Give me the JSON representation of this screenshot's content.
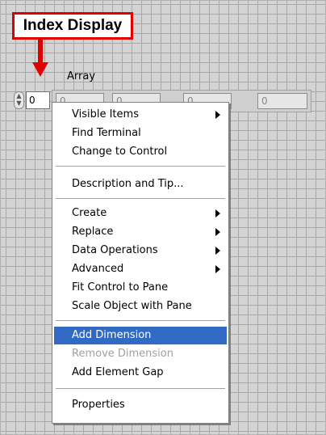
{
  "callout": {
    "text": "Index Display"
  },
  "array": {
    "label": "Array",
    "index_value": "0",
    "element_values": [
      "0",
      "0",
      "0",
      "0"
    ]
  },
  "menu": {
    "items": [
      {
        "label": "Visible Items",
        "submenu": true
      },
      {
        "label": "Find Terminal"
      },
      {
        "label": "Change to Control"
      },
      {
        "label": "Description and Tip..."
      },
      {
        "label": "Create",
        "submenu": true
      },
      {
        "label": "Replace",
        "submenu": true
      },
      {
        "label": "Data Operations",
        "submenu": true
      },
      {
        "label": "Advanced",
        "submenu": true
      },
      {
        "label": "Fit Control to Pane"
      },
      {
        "label": "Scale Object with Pane"
      },
      {
        "label": "Add Dimension",
        "selected": true
      },
      {
        "label": "Remove Dimension",
        "disabled": true
      },
      {
        "label": "Add Element Gap"
      },
      {
        "label": "Properties"
      }
    ]
  },
  "colors": {
    "callout_border": "#e00000",
    "selection": "#316ac5"
  }
}
